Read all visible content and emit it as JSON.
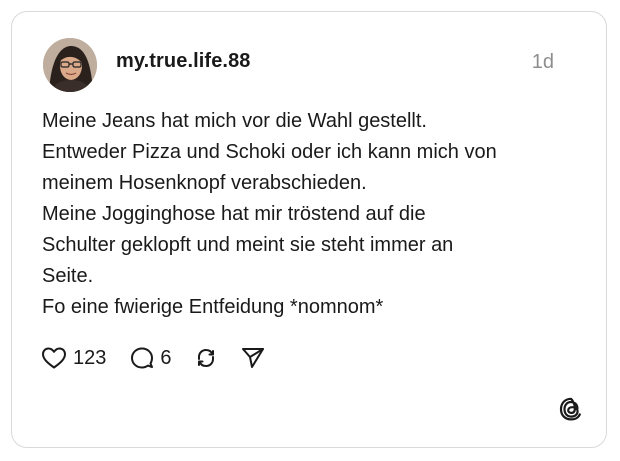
{
  "post": {
    "username": "my.true.life.88",
    "time": "1d",
    "lines": [
      "Meine Jeans hat mich vor die Wahl gestellt.",
      "Entweder Pizza und Schoki oder ich kann mich von",
      "meinem Hosenknopf verabschieden.",
      "Meine Jogginghose hat mir tröstend auf die",
      "Schulter geklopft und meint sie steht immer an",
      "Seite.",
      "Fo eine fwierige Entfeidung *nomnom*"
    ]
  },
  "actions": {
    "likes": "123",
    "replies": "6"
  },
  "icons": {
    "like": "heart-icon",
    "reply": "comment-icon",
    "repost": "repost-icon",
    "share": "send-icon",
    "brand": "threads-logo-icon"
  },
  "colors": {
    "text": "#1a1a1a",
    "muted": "#8e8e8e",
    "border": "#d9d9d9"
  }
}
